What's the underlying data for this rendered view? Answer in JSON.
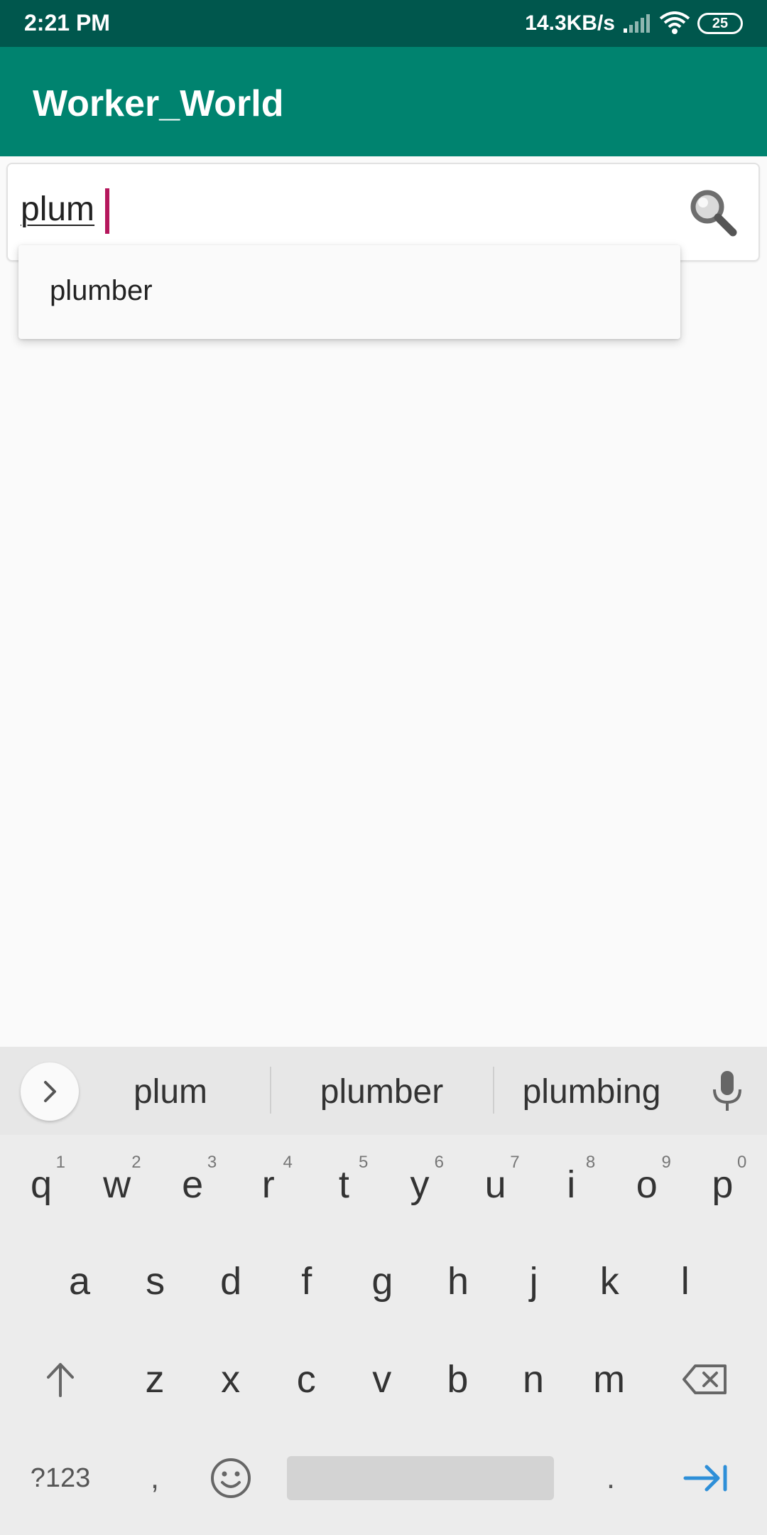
{
  "status_bar": {
    "time": "2:21 PM",
    "network_speed": "14.3KB/s",
    "battery": "25"
  },
  "app_bar": {
    "title": "Worker_World"
  },
  "search": {
    "value": "plum",
    "suggestions": [
      "plumber"
    ]
  },
  "keyboard": {
    "suggestions": [
      "plum",
      "plumber",
      "plumbing"
    ],
    "row1": [
      {
        "key": "q",
        "hint": "1"
      },
      {
        "key": "w",
        "hint": "2"
      },
      {
        "key": "e",
        "hint": "3"
      },
      {
        "key": "r",
        "hint": "4"
      },
      {
        "key": "t",
        "hint": "5"
      },
      {
        "key": "y",
        "hint": "6"
      },
      {
        "key": "u",
        "hint": "7"
      },
      {
        "key": "i",
        "hint": "8"
      },
      {
        "key": "o",
        "hint": "9"
      },
      {
        "key": "p",
        "hint": "0"
      }
    ],
    "row2": [
      "a",
      "s",
      "d",
      "f",
      "g",
      "h",
      "j",
      "k",
      "l"
    ],
    "row3": [
      "z",
      "x",
      "c",
      "v",
      "b",
      "n",
      "m"
    ],
    "symbols_label": "?123",
    "comma": ",",
    "period": ".",
    "accent_color": "#2e8fd8"
  }
}
